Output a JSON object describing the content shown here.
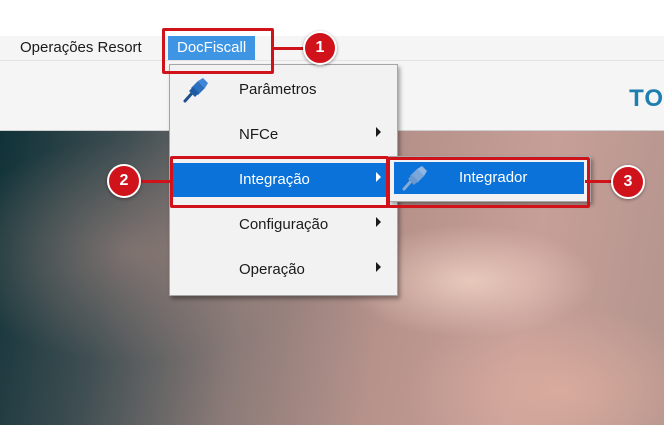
{
  "menubar": {
    "items": [
      {
        "label": "Operações Resort"
      },
      {
        "label": "DocFiscall"
      }
    ]
  },
  "toolbar": {
    "brand_text": "TO"
  },
  "dropdown": {
    "items": [
      {
        "label": "Parâmetros",
        "icon": "pin-icon",
        "has_submenu": false
      },
      {
        "label": "NFCe",
        "has_submenu": true
      },
      {
        "label": "Integração",
        "has_submenu": true,
        "selected": true
      },
      {
        "label": "Configuração",
        "has_submenu": true
      },
      {
        "label": "Operação",
        "has_submenu": true
      }
    ]
  },
  "submenu": {
    "items": [
      {
        "label": "Integrador",
        "icon": "pin-icon",
        "selected": true
      }
    ]
  },
  "annotations": {
    "step1": "1",
    "step2": "2",
    "step3": "3",
    "color": "#d0121b"
  },
  "colors": {
    "menu_selected": "#0a72d8",
    "menubar_active": "#3d95e3",
    "brand": "#1d7fb0"
  }
}
